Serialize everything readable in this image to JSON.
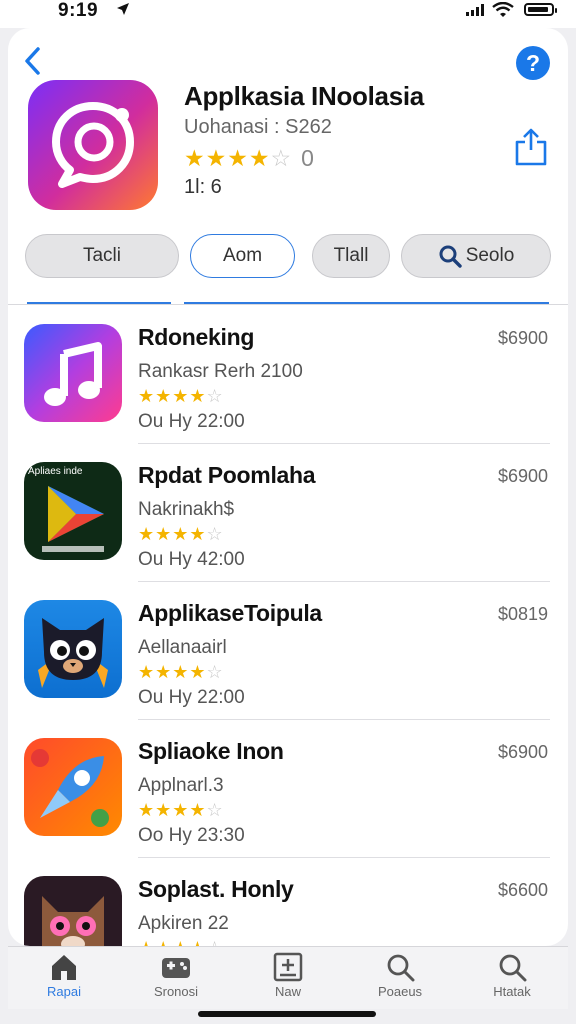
{
  "status": {
    "time": "9:19"
  },
  "header": {
    "app_title": "Applkasia INoolasia",
    "app_subtitle": "Uohanasi : S262",
    "rating_stars": "★★★★",
    "rating_empty": "☆",
    "rating_count": "0",
    "age_line": "1l: 6"
  },
  "tabs": [
    {
      "label": "Tacli"
    },
    {
      "label": "Aom"
    },
    {
      "label": "Tlall"
    },
    {
      "label": "Seolo"
    }
  ],
  "apps": [
    {
      "name": "Rdoneking",
      "sub": "Rankasr Rerh 2100",
      "price": "$6900",
      "stars": "★★★★",
      "empty": "☆",
      "meta": "Ou Hy  22:00",
      "icon": "music-note-icon"
    },
    {
      "name": "Rpdat Poomlaha",
      "sub": "Nakrinakh$",
      "price": "$6900",
      "stars": "★★★★",
      "empty": "☆",
      "meta": "Ou Hy  42:00",
      "icon": "play-triangle-icon",
      "icon_caption": "Apliaes inde"
    },
    {
      "name": "ApplikaseToipula",
      "sub": "Aellanaairl",
      "price": "$0819",
      "stars": "★★★★",
      "empty": "☆",
      "meta": "Ou Hy  22:00",
      "icon": "cat-icon"
    },
    {
      "name": "Spliaoke Inon",
      "sub": "Applnarl.3",
      "price": "$6900",
      "stars": "★★★★",
      "empty": "☆",
      "meta": "Oo Hy  23:30",
      "icon": "rocket-icon"
    },
    {
      "name": "Soplast. Honly",
      "sub": "Apkiren 22",
      "price": "$6600",
      "stars": "★★★★",
      "empty": "☆",
      "meta": "",
      "icon": "bear-icon"
    }
  ],
  "tabbar": [
    {
      "label": "Rapai",
      "icon": "home-icon"
    },
    {
      "label": "Sronosi",
      "icon": "games-icon"
    },
    {
      "label": "Naw",
      "icon": "new-icon"
    },
    {
      "label": "Poaeus",
      "icon": "search-icon"
    },
    {
      "label": "Htatak",
      "icon": "search-icon"
    }
  ],
  "colors": {
    "accent": "#2f7be0",
    "star": "#f4b400"
  }
}
